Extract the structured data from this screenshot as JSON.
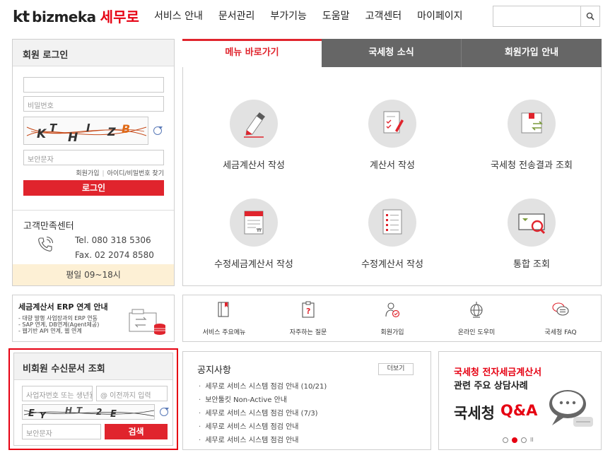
{
  "header": {
    "logo_kt": "kt",
    "logo_bizmeka": "bizmeka",
    "logo_service": "세무로",
    "nav": [
      "서비스 안내",
      "문서관리",
      "부가기능",
      "도움말",
      "고객센터",
      "마이페이지"
    ],
    "search_placeholder": ""
  },
  "login": {
    "title": "회원 로그인",
    "id_placeholder": "",
    "password_placeholder": "비밀번호",
    "captcha_text": "KTHIZB",
    "captcha_placeholder": "보안문자",
    "signup_link": "회원가입",
    "find_link": "아이디/비밀번호 찾기",
    "login_button": "로그인"
  },
  "customer_center": {
    "title": "고객만족센터",
    "tel": "Tel.   080 318 5306",
    "fax": "Fax.   02 2074 8580",
    "hours": "평일 09~18시"
  },
  "tabs": [
    {
      "label": "메뉴 바로가기",
      "active": true
    },
    {
      "label": "국세청 소식",
      "active": false
    },
    {
      "label": "회원가입 안내",
      "active": false
    }
  ],
  "menu_tiles": [
    {
      "label": "세금계산서 작성",
      "icon": "pen-icon"
    },
    {
      "label": "계산서 작성",
      "icon": "document-pen-icon"
    },
    {
      "label": "국세청 전송결과 조회",
      "icon": "transfer-box-icon"
    },
    {
      "label": "수정세금계산서 작성",
      "icon": "edit-tax-invoice-icon"
    },
    {
      "label": "수정계산서 작성",
      "icon": "edit-invoice-icon"
    },
    {
      "label": "통합 조회",
      "icon": "magnifier-icon"
    }
  ],
  "erp": {
    "title": "세금계산서 ERP 연계 안내",
    "lines": [
      "- 대량 발행 사업장과의 ERP 연동",
      "- SAP 연계, DB연계(Agent제공)",
      "- 웹기반 API 연계, 웹 연계"
    ]
  },
  "quick_menu": [
    {
      "label": "서비스 주요메뉴",
      "icon": "book-icon"
    },
    {
      "label": "자주하는 질문",
      "icon": "question-clipboard-icon"
    },
    {
      "label": "회원가입",
      "icon": "user-check-icon"
    },
    {
      "label": "온라인 도우미",
      "icon": "globe-icon"
    },
    {
      "label": "국세청 FAQ",
      "icon": "chat-bubble-icon"
    }
  ],
  "non_member": {
    "title": "비회원 수신문서 조회",
    "biz_placeholder": "사업자번호 또는 생년월일",
    "email_placeholder": "@ 이전까지 입력",
    "captcha_text": "EYHT2E",
    "captcha_placeholder": "보안문자",
    "search_button": "검색"
  },
  "notice": {
    "title": "공지사항",
    "more": "더보기",
    "items": [
      "세무로 서비스 시스템 점검 안내 (10/21)",
      "보안툴킷 Non-Active 안내",
      "세무로 서비스 시스템 점검 안내 (7/3)",
      "세무로 서비스 시스템 점검 안내",
      "세무로 서비스 시스템 점검 안내"
    ]
  },
  "banner": {
    "line1": "국세청 전자세금계산서",
    "line2": "관련 주요 상담사례",
    "qa_part1": "국세청",
    "qa_part2": "Q&A",
    "pause": "II"
  },
  "colors": {
    "brand_red": "#e60012",
    "button_red": "#e0242d",
    "tab_gray": "#666666",
    "hours_bg": "#fdf0d5"
  }
}
